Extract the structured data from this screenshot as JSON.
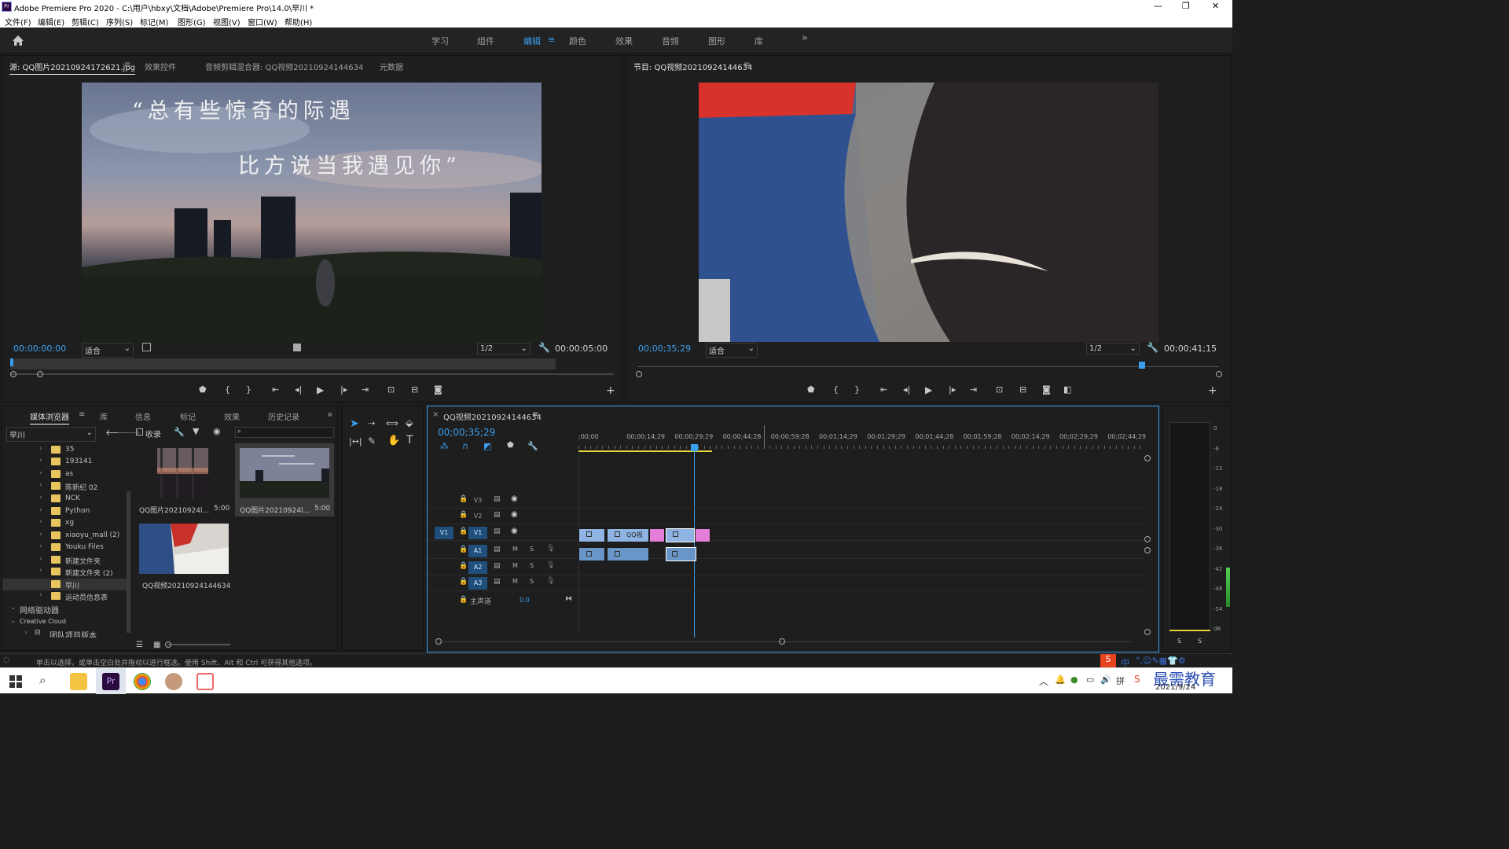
{
  "app": {
    "title": "Adobe Premiere Pro 2020 - C:\\用户\\hbxy\\文档\\Adobe\\Premiere Pro\\14.0\\早川 *",
    "icon": "Pr"
  },
  "window_controls": [
    "—",
    "❐",
    "✕"
  ],
  "menu": [
    "文件(F)",
    "编辑(E)",
    "剪辑(C)",
    "序列(S)",
    "标记(M)",
    "图形(G)",
    "视图(V)",
    "窗口(W)",
    "帮助(H)"
  ],
  "workspaces": [
    "学习",
    "组件",
    "编辑",
    "颜色",
    "效果",
    "音频",
    "图形",
    "库"
  ],
  "workspace_more": "»",
  "source": {
    "tabs": [
      "源: QQ图片20210924172621.jpg",
      "效果控件",
      "音频剪辑混合器: QQ视频20210924144634",
      "元数据"
    ],
    "timecode_in": "00:00:00:00",
    "fit": "适合",
    "quality": "1/2",
    "timecode_out": "00:00:05:00",
    "caption_line1": "“总有些惊奇的际遇",
    "caption_line2": "比方说当我遇见你”"
  },
  "program": {
    "title": "节目: QQ视频20210924144634",
    "timecode_in": "00;00;35;29",
    "fit": "适合",
    "quality": "1/2",
    "timecode_out": "00;00;41;15"
  },
  "transport_icons": [
    "marker-icon",
    "mark-in-icon",
    "mark-out-icon",
    "go-to-in-icon",
    "step-back-icon",
    "play-icon",
    "step-forward-icon",
    "go-to-out-icon",
    "insert-icon",
    "overwrite-icon",
    "export-frame-icon"
  ],
  "project": {
    "tabs": [
      "媒体浏览器",
      "库",
      "信息",
      "标记",
      "效果",
      "历史记录"
    ],
    "location": "早川",
    "ingest_label": "收录",
    "folders": [
      "35",
      "193141",
      "as",
      "陈新纪 02",
      "NCK",
      "Python",
      "xg",
      "xiaoyu_mall (2)",
      "Youku Files",
      "新建文件夹",
      "新建文件夹 (2)",
      "早川",
      "运动员信息表"
    ],
    "network": "网络驱动器",
    "cloud": "Creative Cloud",
    "team": "团队项目版本",
    "thumbs": [
      {
        "name": "QQ图片20210924l...",
        "dur": "5:00"
      },
      {
        "name": "QQ图片20210924l...",
        "dur": "5:00"
      },
      {
        "name": "QQ视频20210924144634",
        "dur": ""
      }
    ]
  },
  "timeline": {
    "title": "QQ视频20210924144634",
    "timecode": "00;00;35;29",
    "ruler": [
      ";00;00",
      "00;00;14;29",
      "00;00;29;29",
      "00;00;44;28",
      "00;00;59;28",
      "00;01;14;29",
      "00;01;29;29",
      "00;01;44;28",
      "00;01;59;28",
      "00;02;14;29",
      "00;02;29;29",
      "00;02;44;29"
    ],
    "tracks": [
      {
        "name": "V3",
        "type": "video"
      },
      {
        "name": "V2",
        "type": "video"
      },
      {
        "name": "V1",
        "type": "video",
        "src": "V1"
      },
      {
        "name": "A1",
        "type": "audio"
      },
      {
        "name": "A2",
        "type": "audio"
      },
      {
        "name": "A3",
        "type": "audio"
      }
    ],
    "master": "主声道",
    "master_value": "0.0",
    "clip_label": "QQ视"
  },
  "meter": {
    "labels": [
      "0",
      "-6",
      "-12",
      "-18",
      "-24",
      "-30",
      "-36",
      "-42",
      "-48",
      "-54",
      "dB"
    ],
    "solo": [
      "S",
      "S"
    ]
  },
  "status_text": "单击以选择，或单击空白处并拖动以进行框选。使用 Shift、Alt 和 Ctrl 可获得其他选项。",
  "taskbar": {
    "date": "2021/9/24",
    "watermark": "最需教育",
    "ime": "中"
  },
  "colors": {
    "accent": "#3b9ff0",
    "clip_video": "#8fb4e3",
    "clip_pink": "#e37fd8",
    "clip_audio": "#6a95c8",
    "folder": "#e8c45e"
  }
}
